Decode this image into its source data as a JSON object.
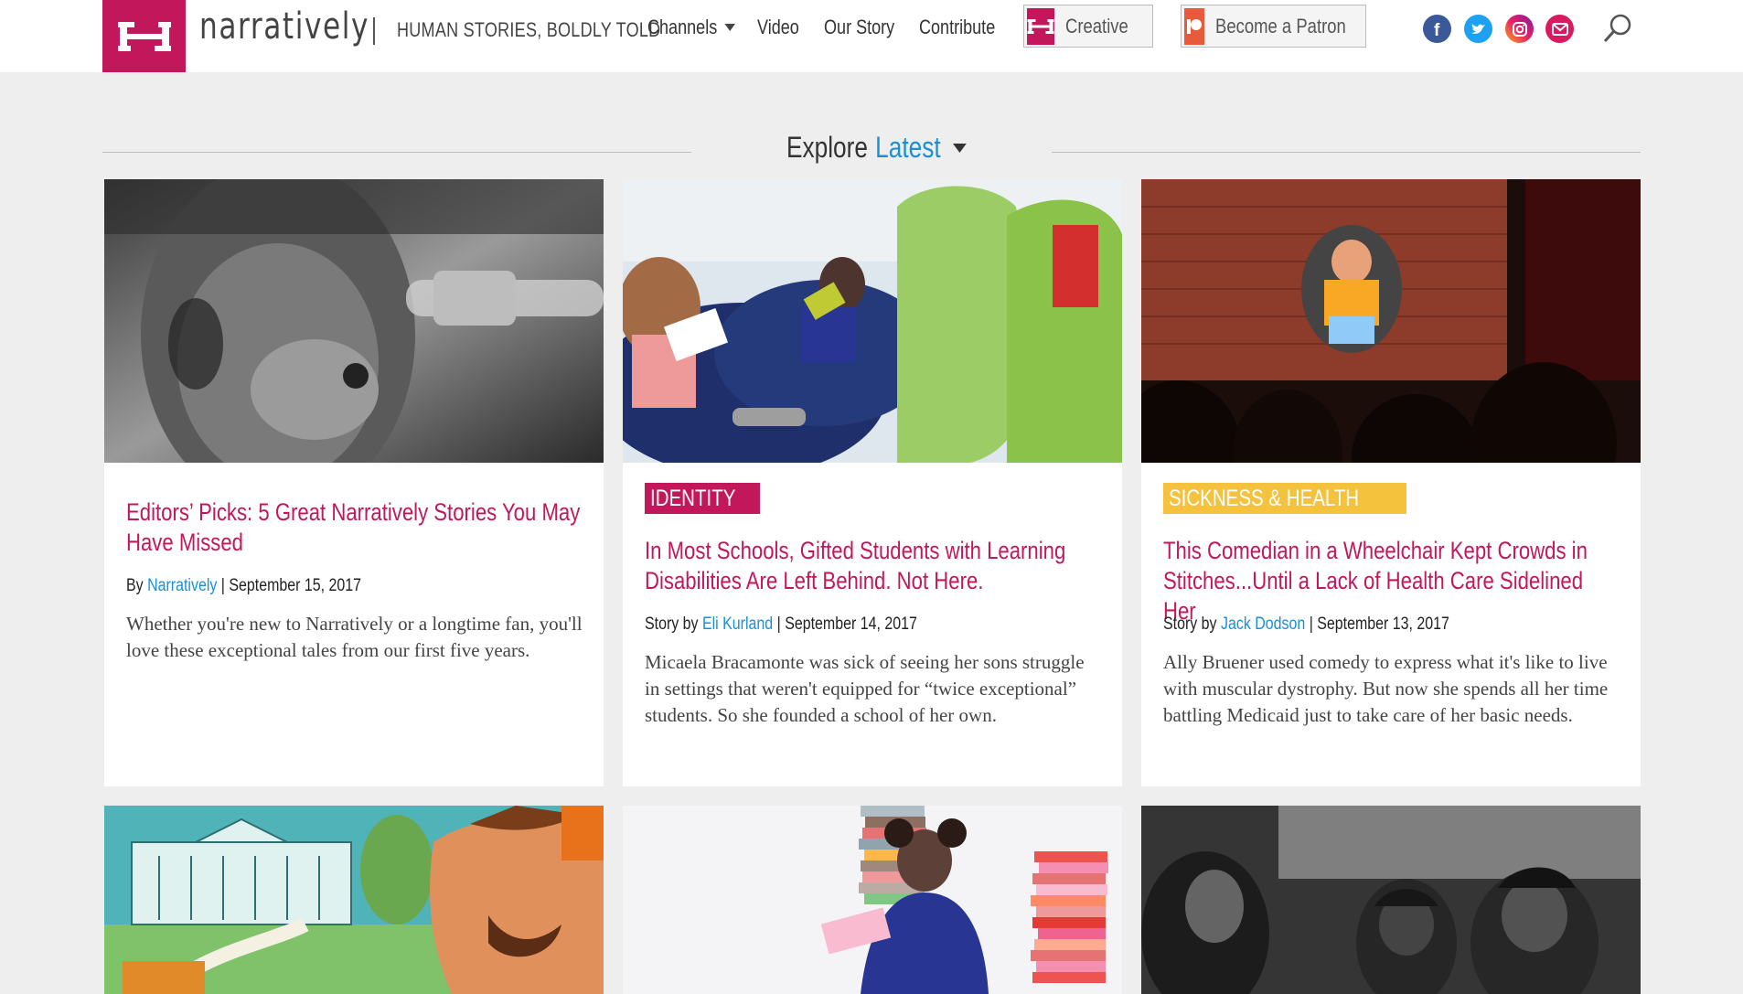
{
  "brand": {
    "logo_icon": "narratively-n-logo",
    "wordmark": "narratively",
    "tagline": "HUMAN STORIES, BOLDLY TOLD",
    "accent_color": "#c2185b",
    "link_color": "#1a8fd8"
  },
  "nav": {
    "items": [
      {
        "label": "Channels",
        "has_dropdown": true
      },
      {
        "label": "Video"
      },
      {
        "label": "Our Story"
      },
      {
        "label": "Contribute"
      }
    ],
    "creative_label": "Creative",
    "patron_label": "Become a Patron",
    "social_icons": [
      "facebook-icon",
      "twitter-icon",
      "instagram-icon",
      "email-icon"
    ],
    "search_icon": "search-icon"
  },
  "explore": {
    "prefix": "Explore",
    "selected": "Latest"
  },
  "cards": [
    {
      "tag": "",
      "title": "Editors’ Picks: 5 Great Narratively Stories You May Have Missed",
      "by_prefix": "By",
      "author": "Narratively",
      "date": "September 15, 2017",
      "excerpt": "Whether you're new to Narratively or a longtime fan, you'll love these exceptional tales from our first five years."
    },
    {
      "tag": "IDENTITY",
      "tag_color": "#c2185b",
      "title": "In Most Schools, Gifted Students with Learning Disabilities Are Left Behind. Not Here.",
      "by_prefix": "Story by",
      "author": "Eli Kurland",
      "date": "September 14, 2017",
      "excerpt": "Micaela Bracamonte was sick of seeing her sons struggle in settings that weren't equipped for “twice exceptional” students. So she founded a school of her own."
    },
    {
      "tag": "SICKNESS & HEALTH",
      "tag_color": "#f5c23e",
      "title": "This Comedian in a Wheelchair Kept Crowds in Stitches...Until a Lack of Health Care Sidelined Her",
      "by_prefix": "Story by",
      "author": "Jack Dodson",
      "date": "September 13, 2017",
      "excerpt": "Ally Bruener used comedy to express what it's like to live with muscular dystrophy. But now she spends all her time battling Medicaid just to take care of her basic needs."
    }
  ]
}
